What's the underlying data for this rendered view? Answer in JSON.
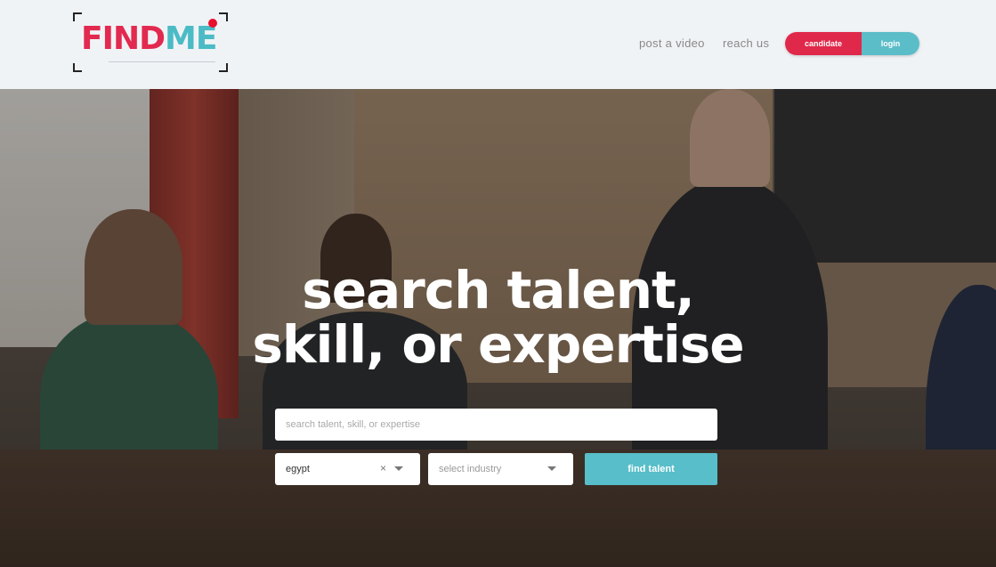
{
  "header": {
    "logo": {
      "find": "FIND",
      "me": "ME"
    },
    "nav": {
      "post_video": "post a video",
      "reach_us": "reach us"
    },
    "auth": {
      "candidate": "candidate",
      "login": "login"
    }
  },
  "hero": {
    "headline_line1": "search talent,",
    "headline_line2": "skill, or expertise",
    "search": {
      "placeholder": "search talent, skill, or expertise",
      "value": ""
    },
    "country_select": {
      "value": "egypt",
      "clear": "×"
    },
    "industry_select": {
      "placeholder": "select industry"
    },
    "find_button": "find talent"
  },
  "colors": {
    "brand_red": "#e0294a",
    "brand_teal": "#5bbdc8"
  }
}
